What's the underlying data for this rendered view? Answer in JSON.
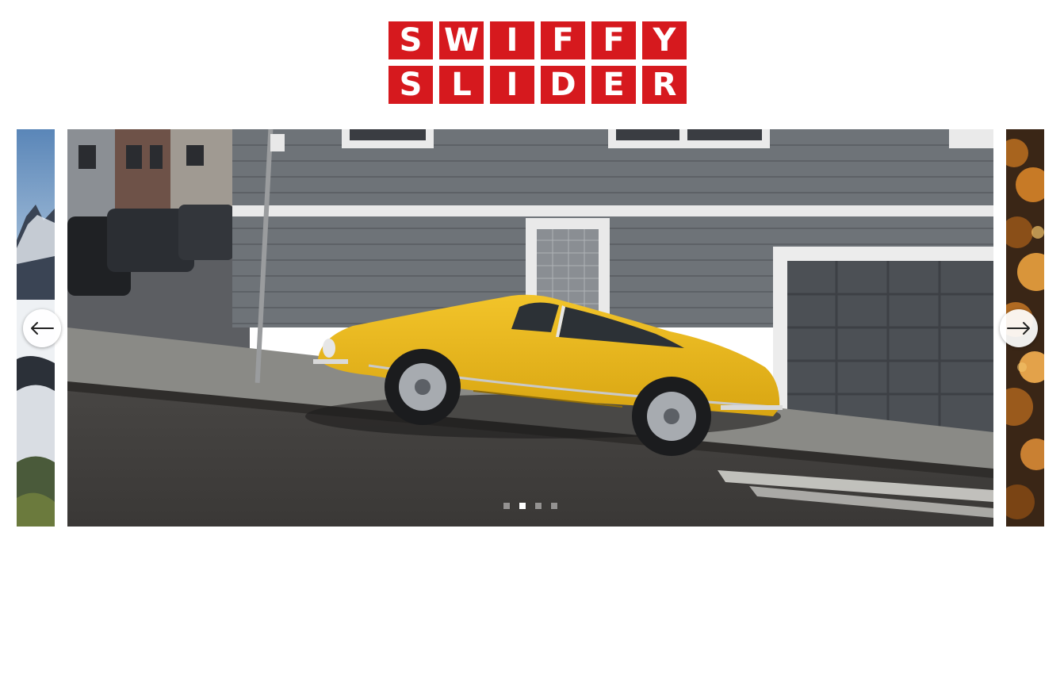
{
  "logo": {
    "row1": [
      "S",
      "W",
      "I",
      "F",
      "F",
      "Y"
    ],
    "row2": [
      "S",
      "L",
      "I",
      "D",
      "E",
      "R"
    ]
  },
  "colors": {
    "brand": "#d6191e",
    "car": "#e6b21a",
    "house_siding": "#6e7378"
  },
  "slider": {
    "slide_count": 4,
    "active_index": 1,
    "prev_icon": "arrow-left-icon",
    "next_icon": "arrow-right-icon"
  }
}
